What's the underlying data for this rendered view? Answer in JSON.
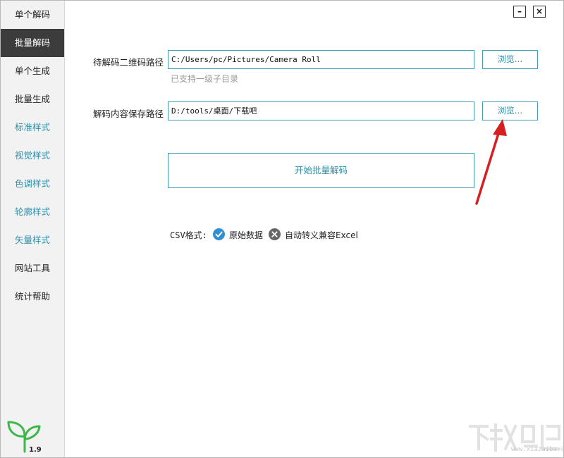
{
  "window": {
    "minimize_label": "–",
    "close_label": "×"
  },
  "sidebar": {
    "items": [
      {
        "label": "单个解码"
      },
      {
        "label": "批量解码"
      },
      {
        "label": "单个生成"
      },
      {
        "label": "批量生成"
      },
      {
        "label": "标准样式"
      },
      {
        "label": "视觉样式"
      },
      {
        "label": "色调样式"
      },
      {
        "label": "轮廓样式"
      },
      {
        "label": "矢量样式"
      },
      {
        "label": "网站工具"
      },
      {
        "label": "统计帮助"
      }
    ],
    "version": "1.9"
  },
  "form": {
    "source_label": "待解码二维码路径",
    "source_value": "C:/Users/pc/Pictures/Camera Roll",
    "source_hint": "已支持一级子目录",
    "save_label": "解码内容保存路径",
    "save_value": "D:/tools/桌面/下载吧",
    "browse_label": "浏览...",
    "start_label": "开始批量解码"
  },
  "csv": {
    "label": "CSV格式:",
    "option_raw": "原始数据",
    "option_excel": "自动转义兼容Excel"
  },
  "watermark": {
    "text": "www.xiazaiba.com"
  },
  "colors": {
    "accent": "#3f9fb4",
    "active_nav": "#3c3c3c",
    "checked": "#2f8fd0",
    "arrow": "#d42020",
    "logo": "#3cb84a"
  }
}
